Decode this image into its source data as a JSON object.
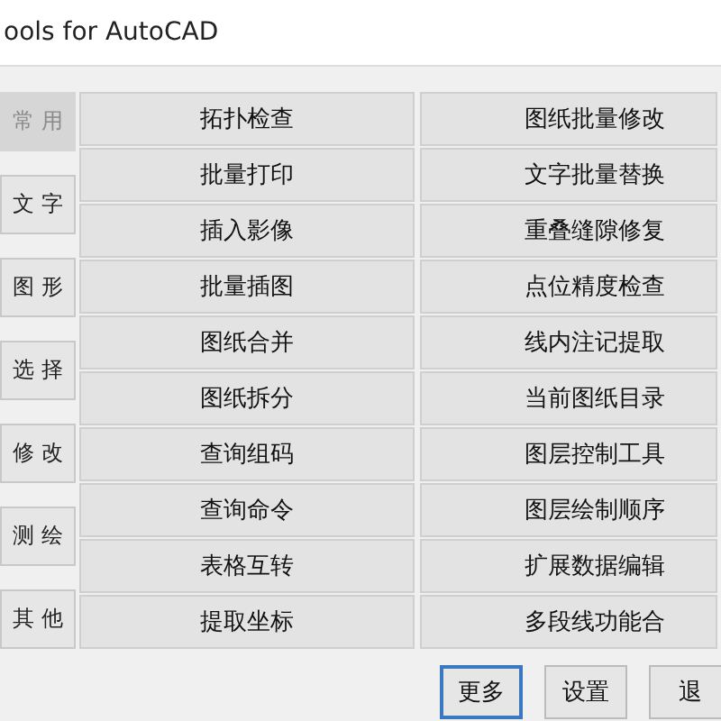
{
  "window": {
    "title": "ools for AutoCAD"
  },
  "sidebar": {
    "items": [
      {
        "label": "常 用",
        "selected": true
      },
      {
        "label": "文 字",
        "selected": false
      },
      {
        "label": "图 形",
        "selected": false
      },
      {
        "label": "选 择",
        "selected": false
      },
      {
        "label": "修 改",
        "selected": false
      },
      {
        "label": "测 绘",
        "selected": false
      },
      {
        "label": "其 他",
        "selected": false
      }
    ]
  },
  "tools": {
    "column_1": [
      "拓扑检查",
      "批量打印",
      "插入影像",
      "批量插图",
      "图纸合并",
      "图纸拆分",
      "查询组码",
      "查询命令",
      "表格互转",
      "提取坐标"
    ],
    "column_2": [
      "图纸批量修改",
      "文字批量替换",
      "重叠缝隙修复",
      "点位精度检查",
      "线内注记提取",
      "当前图纸目录",
      "图层控制工具",
      "图层绘制顺序",
      "扩展数据编辑",
      "多段线功能合"
    ]
  },
  "buttons": [
    {
      "label": "更多",
      "focused": true
    },
    {
      "label": "设置",
      "focused": false
    },
    {
      "label": "退",
      "focused": false
    }
  ]
}
